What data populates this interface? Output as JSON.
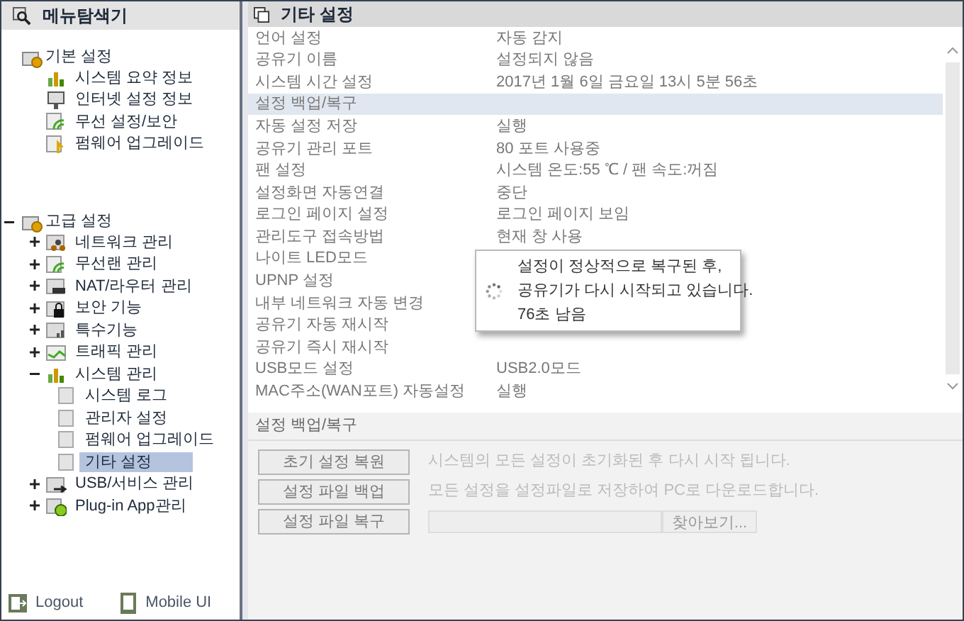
{
  "sidebar": {
    "title": "메뉴탐색기",
    "tree": [
      {
        "label": "기본 설정",
        "children": [
          {
            "label": "시스템 요약 정보",
            "selected": false
          },
          {
            "label": "인터넷 설정 정보",
            "selected": false
          },
          {
            "label": "무선 설정/보안",
            "selected": false
          },
          {
            "label": "펌웨어 업그레이드",
            "selected": false
          }
        ]
      },
      {
        "label": "고급 설정",
        "expanded": true,
        "children": [
          {
            "label": "네트워크 관리",
            "expanded": false
          },
          {
            "label": "무선랜 관리",
            "expanded": false
          },
          {
            "label": "NAT/라우터 관리",
            "expanded": false
          },
          {
            "label": "보안 기능",
            "expanded": false
          },
          {
            "label": "특수기능",
            "expanded": false
          },
          {
            "label": "트래픽 관리",
            "expanded": false
          },
          {
            "label": "시스템 관리",
            "expanded": true,
            "children": [
              {
                "label": "시스템 로그",
                "selected": false
              },
              {
                "label": "관리자 설정",
                "selected": false
              },
              {
                "label": "펌웨어 업그레이드",
                "selected": false
              },
              {
                "label": "기타 설정",
                "selected": true
              }
            ]
          },
          {
            "label": "USB/서비스 관리",
            "expanded": false
          },
          {
            "label": "Plug-in App관리",
            "expanded": false
          }
        ]
      }
    ],
    "footer": [
      {
        "label": "Logout"
      },
      {
        "label": "Mobile UI"
      }
    ]
  },
  "panel": {
    "title": "기타 설정",
    "rows": [
      {
        "label": "언어 설정",
        "value": "자동 감지",
        "selected": false
      },
      {
        "label": "공유기 이름",
        "value": "설정되지 않음",
        "selected": false
      },
      {
        "label": "시스템 시간 설정",
        "value": "2017년 1월 6일 금요일 13시 5분 56초",
        "selected": false
      },
      {
        "label": "설정 백업/복구",
        "selected": true
      },
      {
        "label": "자동 설정 저장",
        "value": "실행",
        "selected": false
      },
      {
        "label": "공유기 관리 포트",
        "value": "80 포트 사용중",
        "selected": false
      },
      {
        "label": "팬 설정",
        "value": "시스템 온도:55 ℃ / 팬 속도:꺼짐",
        "selected": false
      },
      {
        "label": "설정화면 자동연결",
        "value": "중단",
        "selected": false
      },
      {
        "label": "로그인 페이지 설정",
        "value": "로그인 페이지 보임",
        "selected": false
      },
      {
        "label": "관리도구 접속방법",
        "value": "현재 창 사용",
        "selected": false
      },
      {
        "label": "나이트 LED모드",
        "selected": false
      },
      {
        "label": "UPNP 설정",
        "selected": false
      },
      {
        "label": "내부 네트워크 자동 변경",
        "selected": false
      },
      {
        "label": "공유기 자동 재시작",
        "selected": false
      },
      {
        "label": "공유기 즉시 재시작",
        "selected": false
      },
      {
        "label": "USB모드 설정",
        "value": "USB2.0모드",
        "selected": false
      },
      {
        "label": "MAC주소(WAN포트) 자동설정",
        "value": "실행",
        "selected": false
      }
    ],
    "section": {
      "title": "설정 백업/복구",
      "actions": [
        {
          "kind": "description",
          "button": "초기 설정 복원",
          "text": "시스템의 모든 설정이 초기화된 후 다시 시작 됩니다."
        },
        {
          "kind": "description",
          "button": "설정 파일 백업",
          "text": "모든 설정을 설정파일로 저장하여 PC로 다운로드합니다."
        },
        {
          "kind": "file",
          "button": "설정 파일 복구",
          "browse": "찾아보기..."
        }
      ]
    }
  },
  "dialog": {
    "lines": [
      "설정이 정상적으로 복구된 후,",
      "공유기가 다시 시작되고 있습니다.",
      "76초 남음"
    ]
  }
}
